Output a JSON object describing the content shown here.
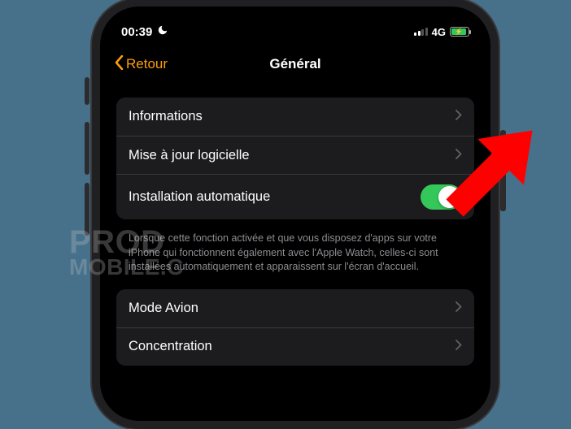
{
  "status_bar": {
    "time": "00:39",
    "network_label": "4G"
  },
  "nav": {
    "back_label": "Retour",
    "title": "Général"
  },
  "section1": {
    "row_info": "Informations",
    "row_update": "Mise à jour logicielle",
    "row_auto_install": "Installation automatique",
    "auto_install_on": true,
    "caption": "Lorsque cette fonction activée et que vous disposez d'apps sur votre iPhone qui fonctionnent également avec l'Apple Watch, celles-ci sont installées automatiquement et apparaissent sur l'écran d'accueil."
  },
  "section2": {
    "row_airplane": "Mode Avion",
    "row_focus": "Concentration"
  },
  "watermark": {
    "line1": "PROD",
    "line2": "MOBILE.C"
  }
}
